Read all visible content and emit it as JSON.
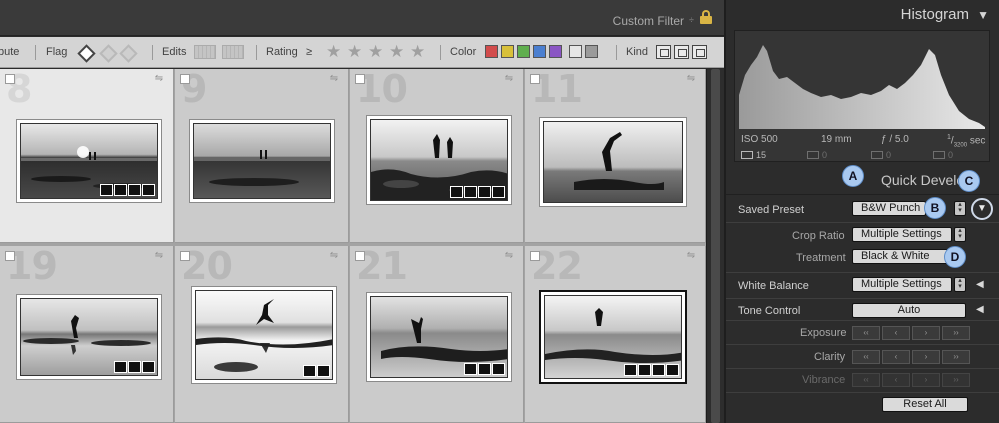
{
  "topbar": {
    "custom_filter": "Custom Filter",
    "filter_arrow": "÷"
  },
  "filterbar": {
    "attribute": "bute",
    "flag": "Flag",
    "edits": "Edits",
    "rating": "Rating",
    "rating_op": "≥",
    "stars": [
      "★",
      "★",
      "★",
      "★",
      "★"
    ],
    "color": "Color",
    "kind": "Kind",
    "swatches": [
      "#d24c4c",
      "#d8c03a",
      "#5fae4e",
      "#4b7fd0",
      "#8a55c4",
      "#e6e6e6",
      "#9a9a9a"
    ]
  },
  "grid": {
    "cells": [
      {
        "num": "8"
      },
      {
        "num": "9"
      },
      {
        "num": "10"
      },
      {
        "num": "11"
      },
      {
        "num": "19"
      },
      {
        "num": "20"
      },
      {
        "num": "21"
      },
      {
        "num": "22"
      }
    ],
    "rotate_glyph": "⇋"
  },
  "histogram": {
    "title": "Histogram",
    "arrow": "▼",
    "iso": "ISO 500",
    "focal": "19 mm",
    "aperture": "ƒ / 5.0",
    "shutter_num": "1",
    "shutter_den": "3200",
    "shutter_unit": "sec",
    "tool_counts": [
      "15",
      "0",
      "0",
      "0"
    ]
  },
  "quick_develop": {
    "title": "Quick Develop",
    "saved_preset_label": "Saved Preset",
    "saved_preset_value": "B&W Punch",
    "crop_ratio_label": "Crop Ratio",
    "crop_ratio_value": "Multiple Settings",
    "treatment_label": "Treatment",
    "treatment_value": "Black & White",
    "white_balance_label": "White Balance",
    "white_balance_value": "Multiple Settings",
    "tone_control_label": "Tone Control",
    "tone_control_value": "Auto",
    "exposure_label": "Exposure",
    "clarity_label": "Clarity",
    "vibrance_label": "Vibrance",
    "reset_all": "Reset All",
    "step_glyphs": [
      "‹‹",
      "‹",
      "›",
      "››"
    ],
    "disclosure": "◀"
  },
  "callouts": {
    "a": "A",
    "b": "B",
    "c": "C",
    "d": "D",
    "c_glyph": "▼"
  }
}
